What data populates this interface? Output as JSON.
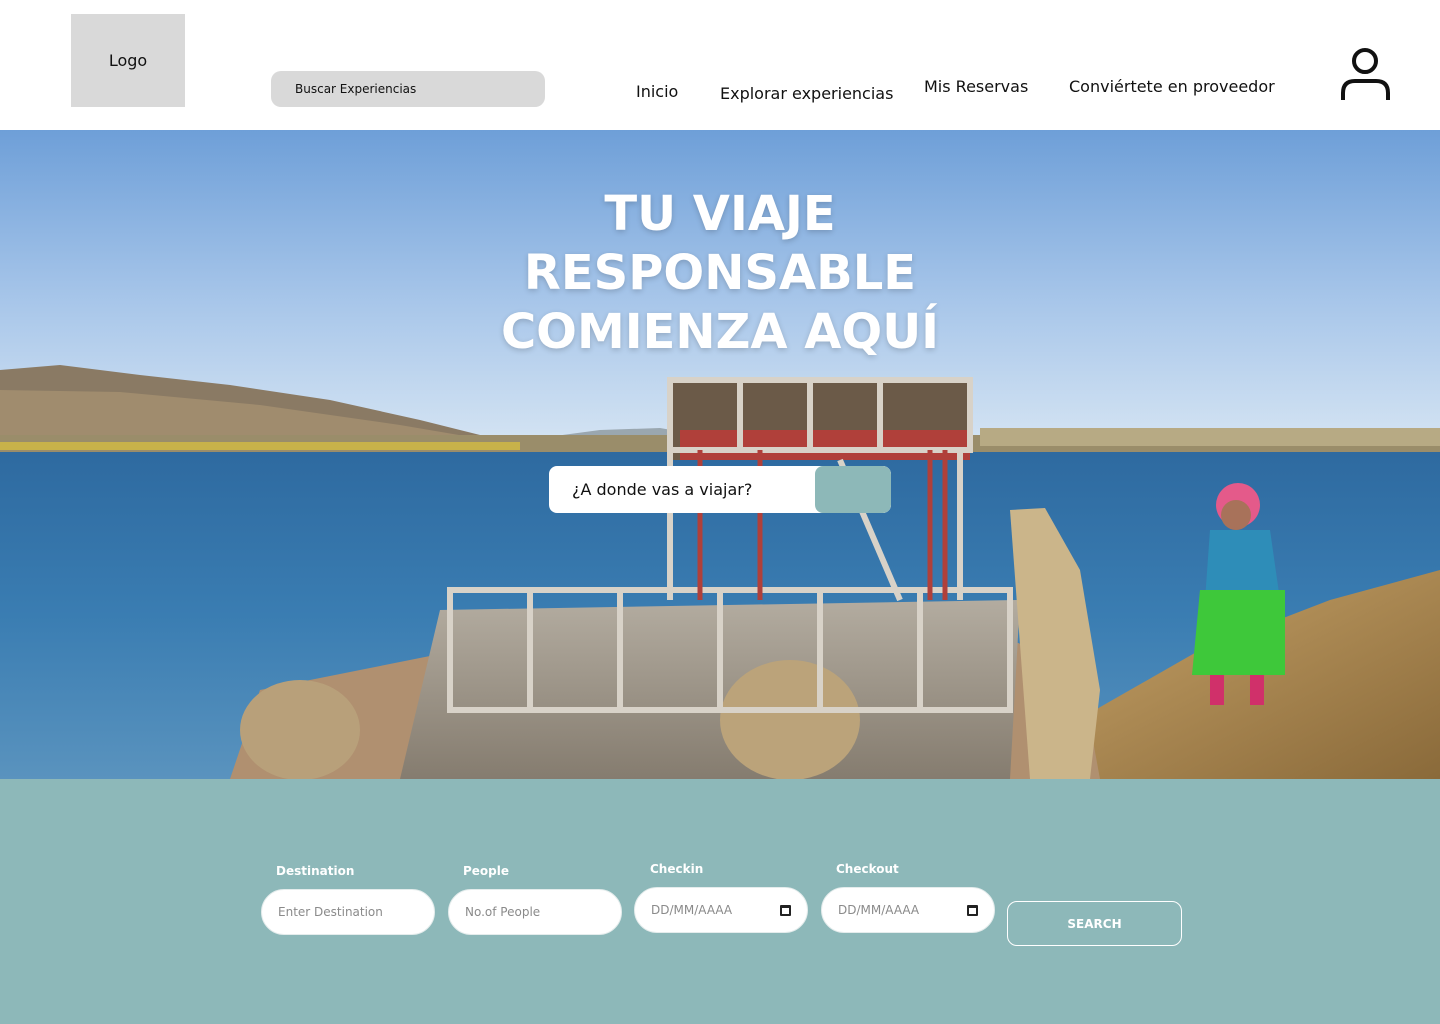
{
  "header": {
    "logo_text": "Logo",
    "search_placeholder": "Buscar Experiencias",
    "nav": {
      "inicio": "Inicio",
      "explorar": "Explorar experiencias",
      "reservas": "Mis Reservas",
      "proveedor": "Conviértete en proveedor"
    },
    "user_icon": "user-icon"
  },
  "hero": {
    "title_lines": [
      "TU VIAJE",
      "RESPONSABLE",
      "COMIENZA AQUÍ"
    ],
    "search_placeholder": "¿A donde vas a viajar?",
    "background": "lake-reed-boat-photo"
  },
  "booking": {
    "destination": {
      "label": "Destination",
      "placeholder": "Enter Destination"
    },
    "people": {
      "label": "People",
      "placeholder": "No.of People"
    },
    "checkin": {
      "label": "Checkin",
      "placeholder": "DD/MM/AAAA"
    },
    "checkout": {
      "label": "Checkout",
      "placeholder": "DD/MM/AAAA"
    },
    "search_label": "SEARCH"
  },
  "colors": {
    "accent": "#8db8b9",
    "logo_bg": "#d9d9d9",
    "white": "#ffffff"
  }
}
